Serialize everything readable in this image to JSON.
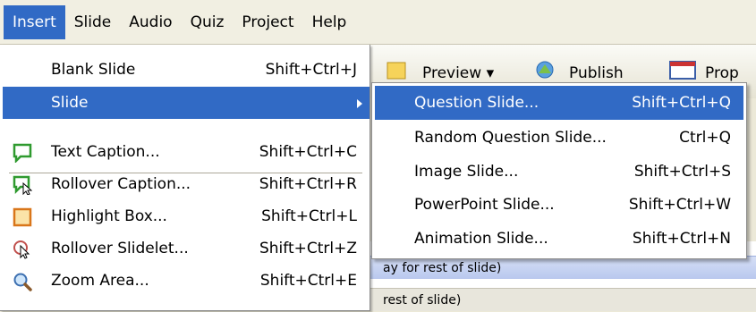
{
  "menubar": {
    "items": [
      {
        "label": "Insert"
      },
      {
        "label": "Slide"
      },
      {
        "label": "Audio"
      },
      {
        "label": "Quiz"
      },
      {
        "label": "Project"
      },
      {
        "label": "Help"
      }
    ]
  },
  "toolbar": {
    "preview_label": "Preview",
    "publish_label": "Publish",
    "properties_label": "Prop"
  },
  "background": {
    "row1_text": "ay for rest of slide)",
    "row2_text": "rest of slide)"
  },
  "insert_menu": {
    "items": [
      {
        "label": "Blank Slide",
        "shortcut": "Shift+Ctrl+J",
        "icon": "none"
      },
      {
        "label": "Slide",
        "shortcut": "",
        "icon": "none",
        "submenu": true
      },
      {
        "label": "Text Caption...",
        "shortcut": "Shift+Ctrl+C",
        "icon": "text-caption-icon"
      },
      {
        "label": "Rollover Caption...",
        "shortcut": "Shift+Ctrl+R",
        "icon": "rollover-caption-icon"
      },
      {
        "label": "Highlight Box...",
        "shortcut": "Shift+Ctrl+L",
        "icon": "highlight-box-icon"
      },
      {
        "label": "Rollover Slidelet...",
        "shortcut": "Shift+Ctrl+Z",
        "icon": "rollover-slidelet-icon"
      },
      {
        "label": "Zoom Area...",
        "shortcut": "Shift+Ctrl+E",
        "icon": "zoom-area-icon"
      }
    ]
  },
  "slide_submenu": {
    "items": [
      {
        "label": "Question Slide...",
        "shortcut": "Shift+Ctrl+Q"
      },
      {
        "label": "Random Question Slide...",
        "shortcut": "Ctrl+Q"
      },
      {
        "label": "Image Slide...",
        "shortcut": "Shift+Ctrl+S"
      },
      {
        "label": "PowerPoint Slide...",
        "shortcut": "Shift+Ctrl+W"
      },
      {
        "label": "Animation Slide...",
        "shortcut": "Shift+Ctrl+N"
      }
    ]
  },
  "colors": {
    "highlight": "#316ac5",
    "menu_bg": "#ffffff",
    "menubar_bg": "#f1efe2"
  }
}
